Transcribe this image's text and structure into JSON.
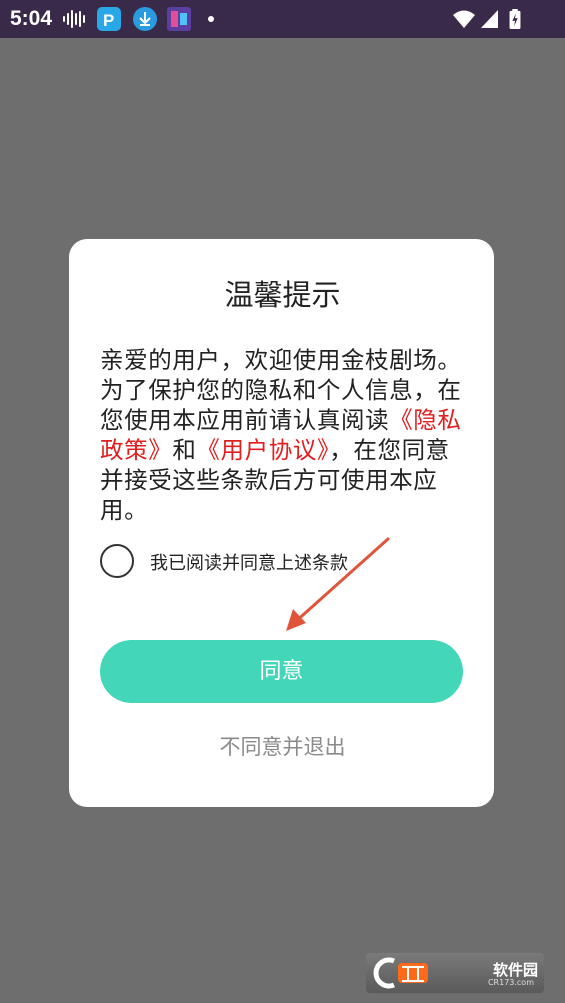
{
  "status_bar": {
    "time": "5:04"
  },
  "dialog": {
    "title": "温馨提示",
    "body_part1": "亲爱的用户，欢迎使用金枝剧场。为了保护您的隐私和个人信息，在您使用本应用前请认真阅读",
    "privacy_link": "《隐私政策》",
    "body_and": "和",
    "user_link": "《用户协议》",
    "body_part2": "，在您同意并接受这些条款后方可使用本应用。",
    "checkbox_label": "我已阅读并同意上述条款",
    "agree_label": "同意",
    "disagree_label": "不同意并退出"
  },
  "watermark": {
    "brand": "软件园",
    "sub": "CR173.com"
  },
  "colors": {
    "accent": "#43d6b9",
    "link": "#e02020",
    "annotation_arrow": "#e0553a"
  }
}
